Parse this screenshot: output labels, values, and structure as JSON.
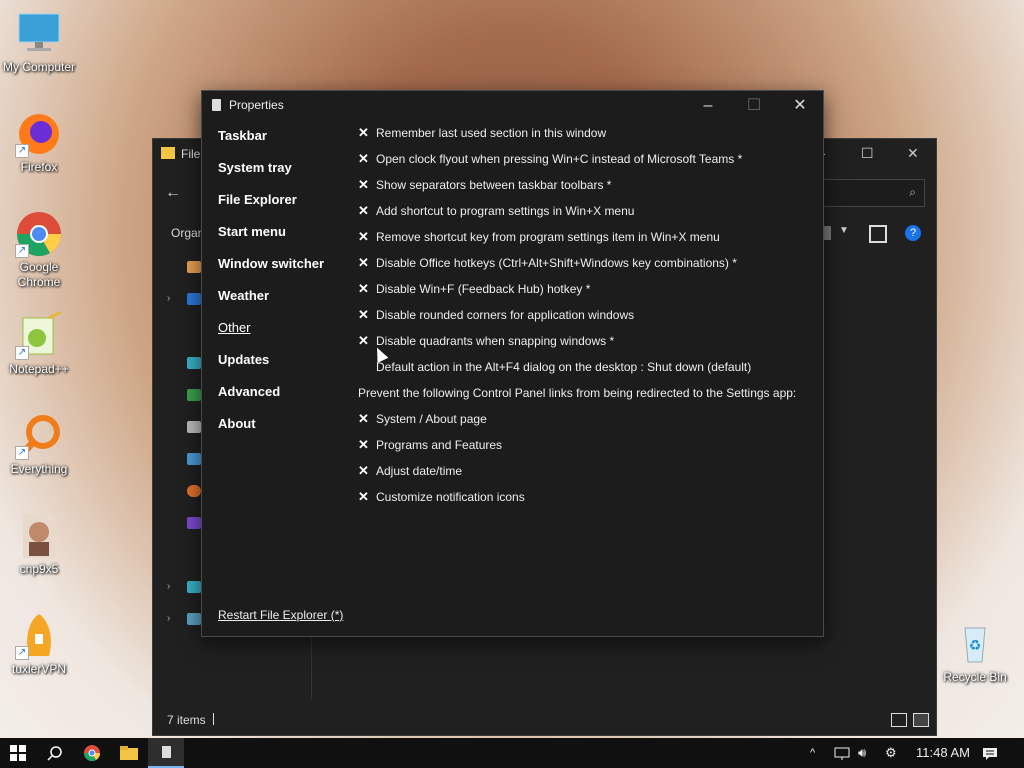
{
  "desktop": {
    "icons": [
      {
        "label": "My Computer",
        "icon": "monitor-icon"
      },
      {
        "label": "Firefox",
        "icon": "firefox-icon"
      },
      {
        "label": "Google Chrome",
        "icon": "chrome-icon"
      },
      {
        "label": "Notepad++",
        "icon": "notepadpp-icon"
      },
      {
        "label": "Everything",
        "icon": "magnifier-icon"
      },
      {
        "label": "cnp9x5",
        "icon": "user-photo-icon"
      },
      {
        "label": "tuxlerVPN",
        "icon": "vpn-icon"
      },
      {
        "label": "Recycle Bin",
        "icon": "recycle-bin-icon"
      }
    ]
  },
  "explorer": {
    "title": "File",
    "toolbar_label": "Organ",
    "status": "7 items"
  },
  "properties": {
    "title": "Properties",
    "sidebar": [
      {
        "label": "Taskbar"
      },
      {
        "label": "System tray"
      },
      {
        "label": "File Explorer"
      },
      {
        "label": "Start menu"
      },
      {
        "label": "Window switcher"
      },
      {
        "label": "Weather"
      },
      {
        "label": "Other"
      },
      {
        "label": "Updates"
      },
      {
        "label": "Advanced"
      },
      {
        "label": "About"
      }
    ],
    "active_section": "Other",
    "options": [
      {
        "label": "Remember last used section in this window",
        "checked": true
      },
      {
        "label": "Open clock flyout when pressing Win+C instead of Microsoft Teams *",
        "checked": true
      },
      {
        "label": "Show separators between taskbar toolbars *",
        "checked": true
      },
      {
        "label": "Add shortcut to program settings in Win+X menu",
        "checked": true
      },
      {
        "label": "Remove shortcut key from program settings item in Win+X menu",
        "checked": true
      },
      {
        "label": "Disable Office hotkeys (Ctrl+Alt+Shift+Windows key combinations) *",
        "checked": true
      },
      {
        "label": "Disable Win+F (Feedback Hub) hotkey *",
        "checked": true
      },
      {
        "label": "Disable rounded corners for application windows",
        "checked": true
      },
      {
        "label": "Disable quadrants when snapping windows *",
        "checked": true
      }
    ],
    "default_action": "Default action in the Alt+F4 dialog on the desktop : Shut down (default)",
    "redirect_heading": "Prevent the following Control Panel links from being redirected to the Settings app:",
    "redirect_options": [
      {
        "label": "System / About page",
        "checked": true
      },
      {
        "label": "Programs and Features",
        "checked": true
      },
      {
        "label": "Adjust date/time",
        "checked": true
      },
      {
        "label": "Customize notification icons",
        "checked": true
      }
    ],
    "restart_link": "Restart File Explorer (*)"
  },
  "taskbar": {
    "clock": "11:48 AM",
    "pinned": [
      "windows-start-icon",
      "search-icon",
      "chrome-icon",
      "file-explorer-icon",
      "properties-app-icon"
    ]
  }
}
